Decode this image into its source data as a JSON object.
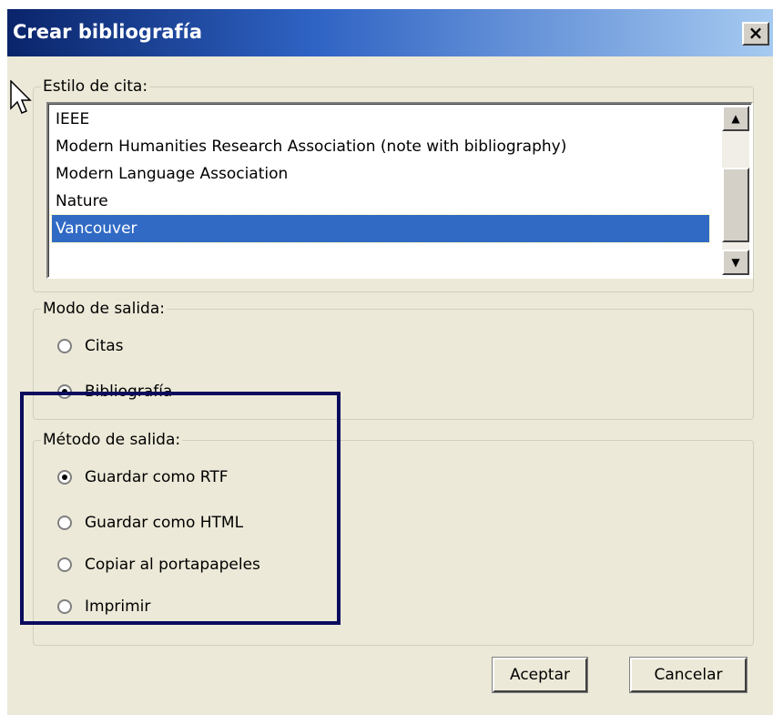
{
  "window": {
    "title": "Crear bibliografía",
    "close_label": "×"
  },
  "citation_style": {
    "label": "Estilo de cita:",
    "items": [
      "IEEE",
      "Modern Humanities Research Association (note with bibliography)",
      "Modern Language Association",
      "Nature",
      "Vancouver"
    ],
    "selected": "Vancouver"
  },
  "output_mode": {
    "label": "Modo de salida:",
    "options": [
      {
        "label": "Citas",
        "checked": false
      },
      {
        "label": "Bibliografía",
        "checked": true
      }
    ]
  },
  "output_method": {
    "label": "Método de salida:",
    "options": [
      {
        "label": "Guardar como RTF",
        "checked": true
      },
      {
        "label": "Guardar como HTML",
        "checked": false
      },
      {
        "label": "Copiar al portapapeles",
        "checked": false
      },
      {
        "label": "Imprimir",
        "checked": false
      }
    ]
  },
  "buttons": {
    "accept": "Aceptar",
    "cancel": "Cancelar"
  },
  "colors": {
    "selection": "#316ac5",
    "highlight_box": "#0b0b5e",
    "title_gradient_start": "#0a246a"
  }
}
